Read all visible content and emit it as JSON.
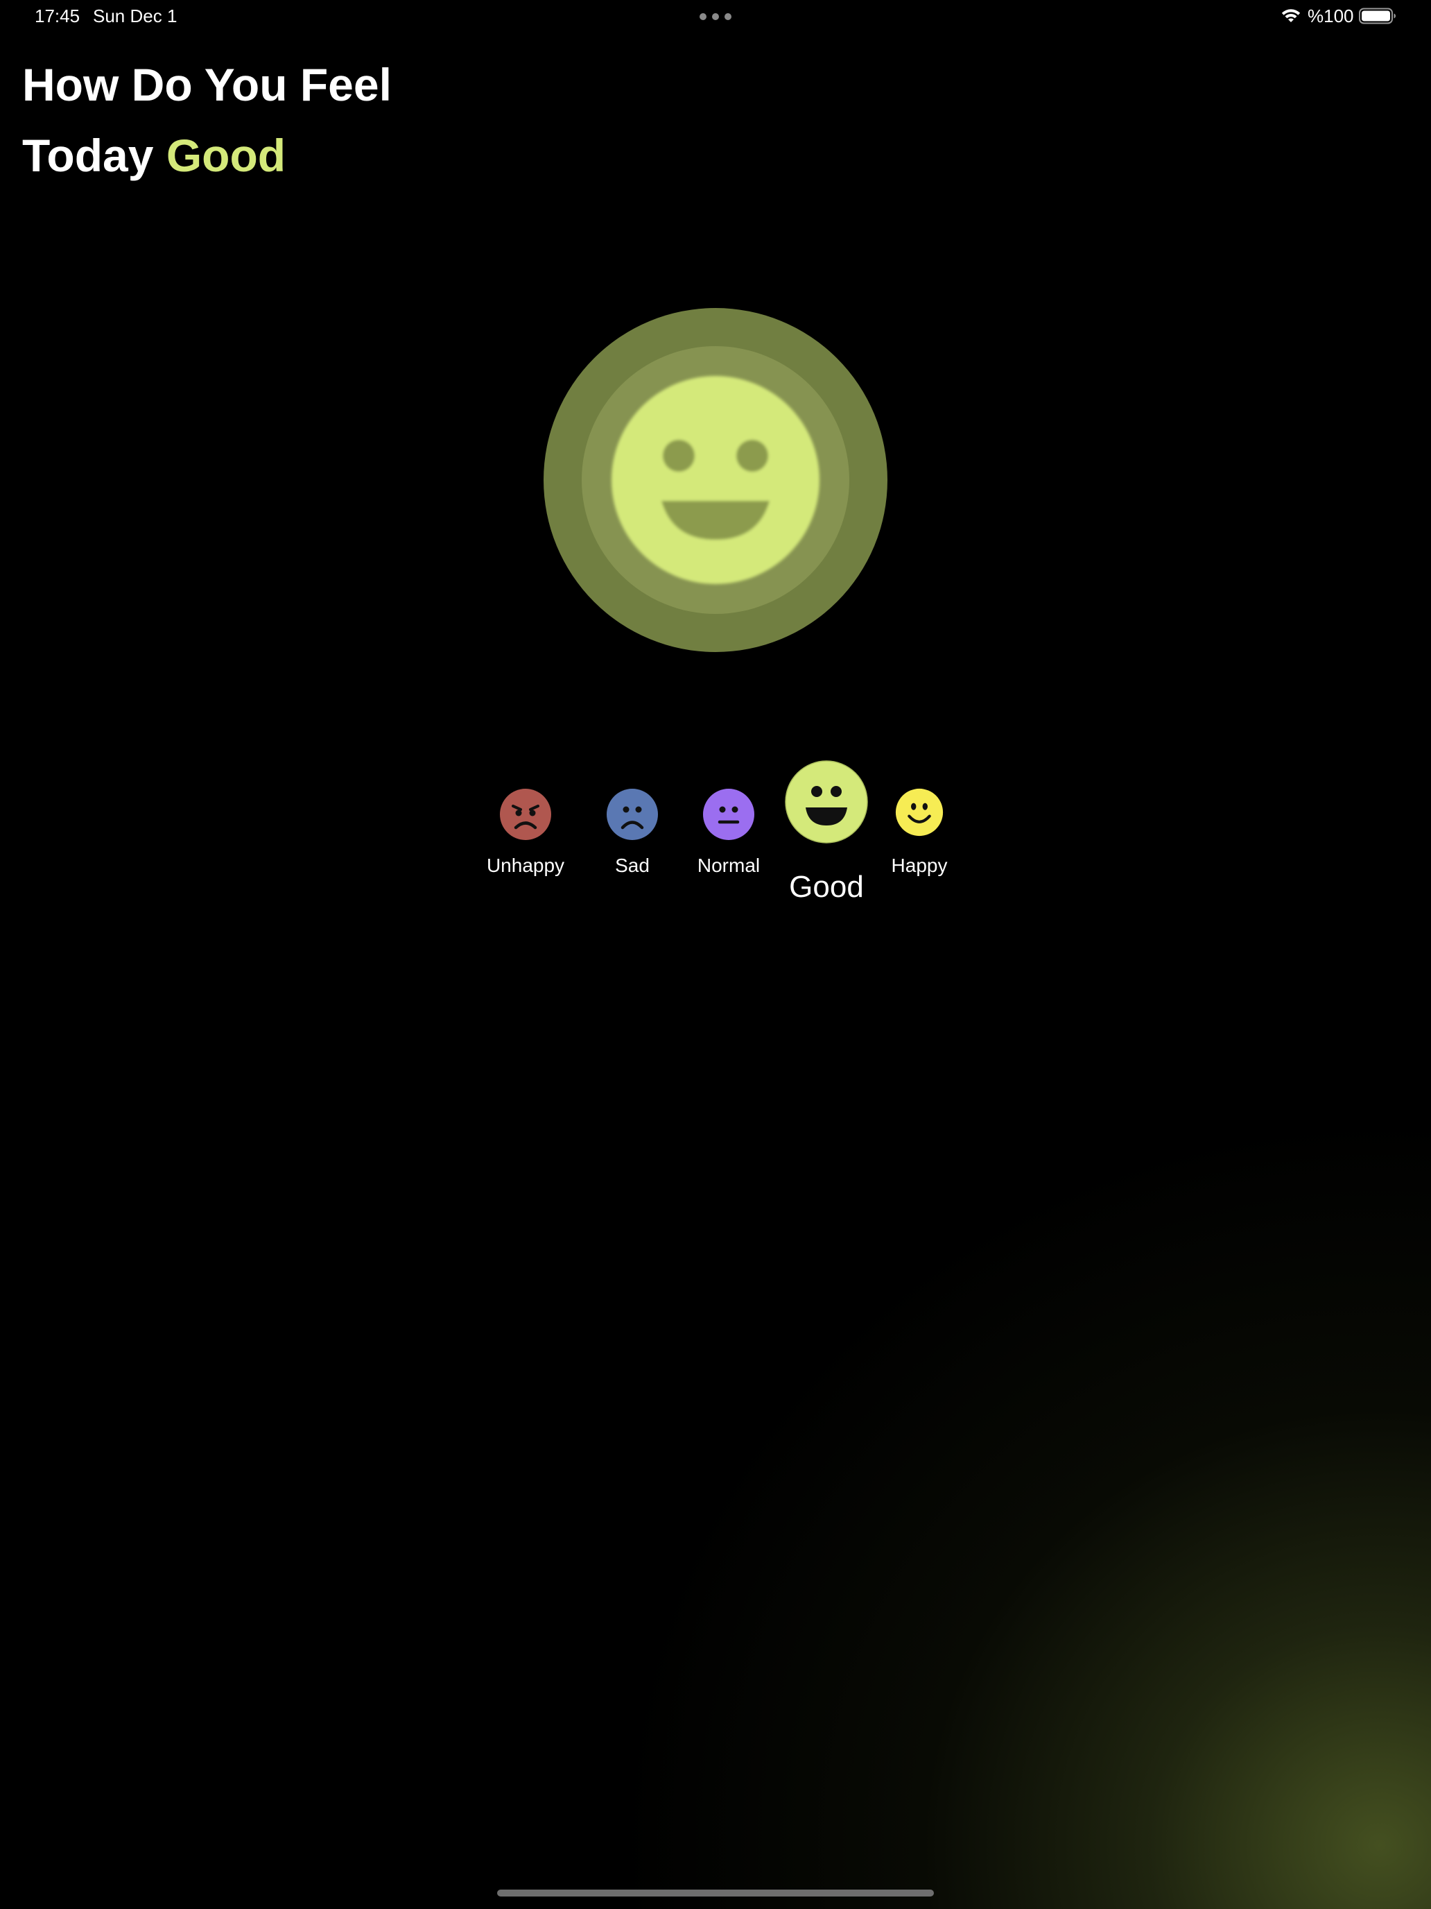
{
  "status_bar": {
    "time": "17:45",
    "date": "Sun Dec 1",
    "battery": "%100",
    "wifi_icon": "wifi-icon",
    "battery_icon": "battery-icon"
  },
  "header": {
    "line1": "How Do You Feel",
    "line2_prefix": "Today",
    "selected_mood": "Good"
  },
  "colors": {
    "background": "#000000",
    "accent": "#d4e97a",
    "unhappy": "#b0574f",
    "sad": "#5a78b3",
    "normal": "#9b6ef0",
    "good": "#d4e97a",
    "happy": "#f6ec54"
  },
  "moods": [
    {
      "label": "Unhappy",
      "icon": "angry-face-icon",
      "selected": false
    },
    {
      "label": "Sad",
      "icon": "frowning-face-icon",
      "selected": false
    },
    {
      "label": "Normal",
      "icon": "neutral-face-icon",
      "selected": false
    },
    {
      "label": "Good",
      "icon": "grinning-face-icon",
      "selected": true
    },
    {
      "label": "Happy",
      "icon": "smiling-face-icon",
      "selected": false
    }
  ]
}
